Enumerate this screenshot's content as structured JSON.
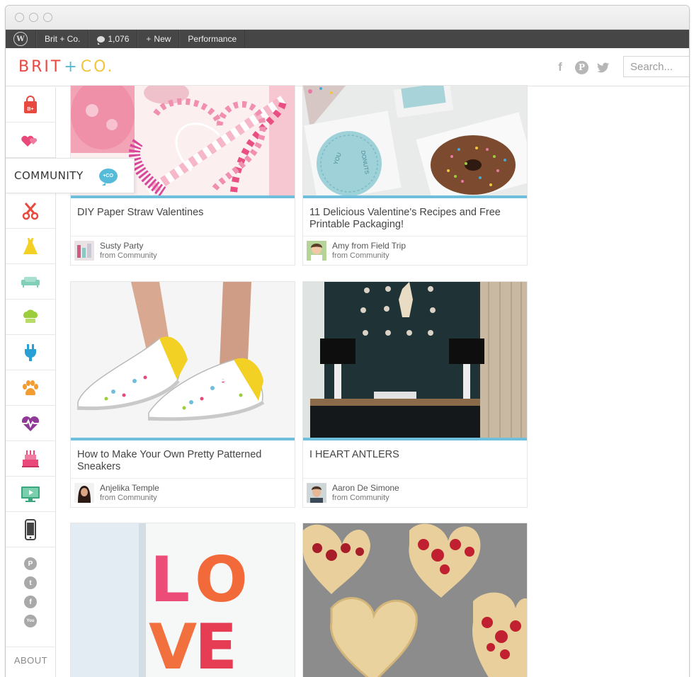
{
  "adminbar": {
    "site_name": "Brit + Co.",
    "comments_count": "1,076",
    "new_label": "New",
    "performance_label": "Performance"
  },
  "header": {
    "logo_parts": [
      "BRIT",
      "+",
      "CO."
    ],
    "social_icons": [
      "facebook-icon",
      "pinterest-icon",
      "twitter-icon"
    ],
    "search_placeholder": "Search..."
  },
  "sidebar": {
    "community_label": "COMMUNITY",
    "community_badge": "+CO",
    "categories": [
      {
        "icon": "shopping-bag-icon",
        "color": "#e84a3f"
      },
      {
        "icon": "hearts-icon",
        "color": "#e8497a"
      },
      {
        "icon": "community-icon",
        "color": "#55bbd9"
      },
      {
        "icon": "scissors-icon",
        "color": "#e84a3f"
      },
      {
        "icon": "dress-icon",
        "color": "#f2d024"
      },
      {
        "icon": "sofa-icon",
        "color": "#7fcfb9"
      },
      {
        "icon": "chef-hat-icon",
        "color": "#9ccd3a"
      },
      {
        "icon": "plug-icon",
        "color": "#2a9fd4"
      },
      {
        "icon": "paw-icon",
        "color": "#f39c32"
      },
      {
        "icon": "heartbeat-icon",
        "color": "#8e3b97"
      },
      {
        "icon": "cake-icon",
        "color": "#e8497a"
      },
      {
        "icon": "monitor-icon",
        "color": "#3aa77e"
      },
      {
        "icon": "phone-icon",
        "color": "#444444"
      }
    ],
    "social": [
      "P",
      "t",
      "f",
      "You"
    ],
    "about_label": "ABOUT"
  },
  "cards": [
    {
      "title": "DIY Paper Straw Valentines",
      "author": "Susty Party",
      "from": "from Community"
    },
    {
      "title": "11 Delicious Valentine's Recipes and Free Printable Packaging!",
      "author": "Amy from Field Trip",
      "from": "from Community"
    },
    {
      "title": "How to Make Your Own Pretty Patterned Sneakers",
      "author": "Anjelika Temple",
      "from": "from Community"
    },
    {
      "title": "I HEART ANTLERS",
      "author": "Aaron De Simone",
      "from": "from Community"
    },
    {
      "title": "",
      "author": "",
      "from": ""
    },
    {
      "title": "",
      "author": "",
      "from": ""
    }
  ],
  "artwork": {
    "love_letters": [
      "L",
      "O",
      "V",
      "E"
    ]
  },
  "colors": {
    "accent_blue": "#6fbfdc",
    "adminbar_bg": "#464646"
  }
}
